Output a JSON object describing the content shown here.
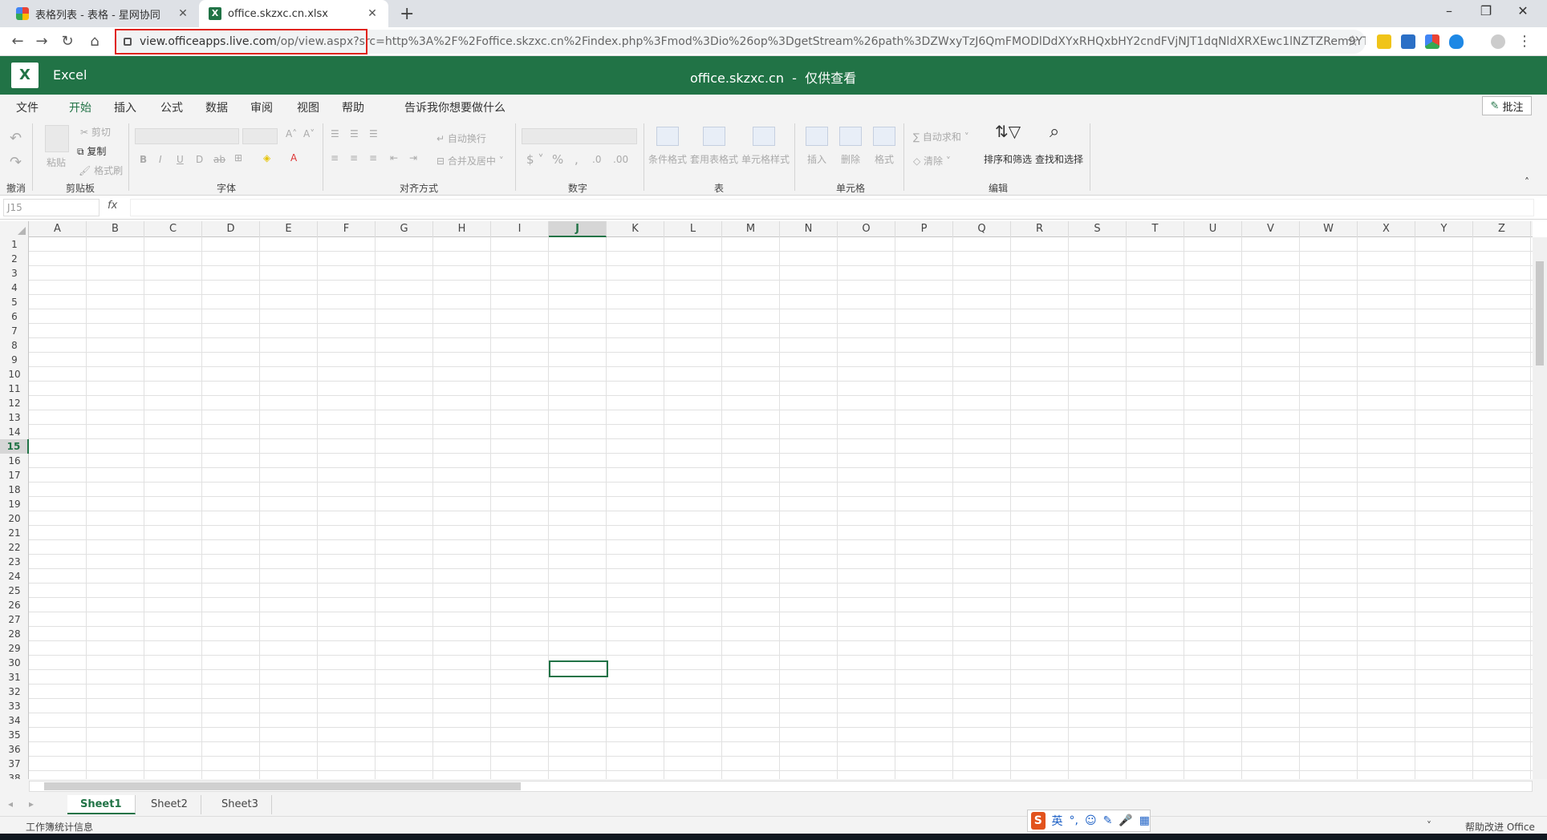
{
  "browser": {
    "tabs": [
      {
        "title": "表格列表 - 表格 - 星网协同",
        "active": false
      },
      {
        "title": "office.skzxc.cn.xlsx",
        "active": true
      }
    ],
    "new_tab": "+",
    "close": "✕",
    "url_host": "view.officeapps.live.com",
    "url_rest": "/op/view.aspx?src=http%3A%2F%2Foffice.skzxc.cn%2Findex.php%3Fmod%3Dio%26op%3DgetStream%26path%3DZWxyTzJ6QmFMODlDdXYxRHQxbHY2cndFVjNJT1dqNldXRXEwc1lNZTZRem9YT..."
  },
  "app": {
    "name": "Excel",
    "doc": "office.skzxc.cn",
    "sep": "-",
    "mode": "仅供查看"
  },
  "menu": [
    "文件",
    "开始",
    "插入",
    "公式",
    "数据",
    "审阅",
    "视图",
    "帮助",
    "告诉我你想要做什么"
  ],
  "comment_label": "批注",
  "ribbon": {
    "clipboard": {
      "paste": "粘贴",
      "cut": "剪切",
      "copy": "复制",
      "format_painter": "格式刷",
      "label": "剪贴板"
    },
    "undo_label": "撤消",
    "font_label": "字体",
    "align": {
      "wrap": "自动换行",
      "merge": "合并及居中",
      "label": "对齐方式"
    },
    "number_label": "数字",
    "table": {
      "cond": "条件格式",
      "astable": "套用表格式",
      "cellstyle": "单元格样式",
      "label": "表"
    },
    "cells": {
      "insert": "插入",
      "delete": "删除",
      "format": "格式",
      "label": "单元格"
    },
    "edit": {
      "autosum": "自动求和",
      "clear": "清除",
      "sort": "排序和筛选",
      "find": "查找和选择",
      "label": "编辑"
    }
  },
  "formula_bar": {
    "namebox": "J15",
    "fx": "fx",
    "value": ""
  },
  "grid": {
    "columns": [
      "A",
      "B",
      "C",
      "D",
      "E",
      "F",
      "G",
      "H",
      "I",
      "J",
      "K",
      "L",
      "M",
      "N",
      "O",
      "P",
      "Q",
      "R",
      "S",
      "T",
      "U",
      "V",
      "W",
      "X",
      "Y",
      "Z"
    ],
    "rows": [
      "1",
      "2",
      "3",
      "4",
      "5",
      "6",
      "7",
      "8",
      "9",
      "10",
      "11",
      "12",
      "13",
      "14",
      "15",
      "16",
      "17",
      "18",
      "19",
      "20",
      "21",
      "22",
      "23",
      "24",
      "25",
      "26",
      "27",
      "28",
      "29",
      "30",
      "31",
      "32",
      "33",
      "34",
      "35",
      "36",
      "37",
      "38"
    ],
    "selected_col": "J",
    "selected_row": "15"
  },
  "sheets": [
    "Sheet1",
    "Sheet2",
    "Sheet3"
  ],
  "active_sheet": "Sheet1",
  "status": {
    "left": "工作簿统计信息",
    "right": "帮助改进 Office"
  },
  "ime": {
    "lang": "英"
  }
}
